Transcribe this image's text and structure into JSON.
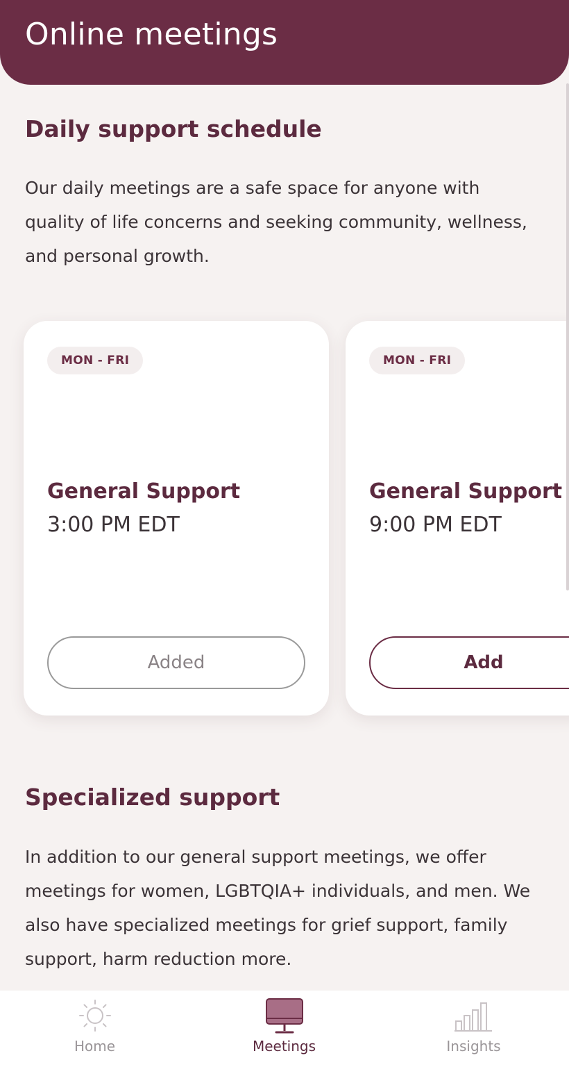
{
  "header": {
    "title": "Online meetings"
  },
  "daily": {
    "title": "Daily support schedule",
    "body": "Our daily meetings are a safe space for anyone with quality of life concerns and seeking community, wellness, and personal growth."
  },
  "cards": [
    {
      "badge": "MON - FRI",
      "title": "General Support",
      "time": "3:00 PM EDT",
      "button": "Added"
    },
    {
      "badge": "MON - FRI",
      "title": "General Support",
      "time": "9:00 PM EDT",
      "button": "Add"
    }
  ],
  "specialized": {
    "title": "Specialized support",
    "body": "In addition to our general support meetings, we offer meetings for women, LGBTQIA+ individuals, and men. We also have specialized meetings for grief support, family support, harm reduction more."
  },
  "tabs": [
    {
      "label": "Home",
      "icon": "sun-icon"
    },
    {
      "label": "Meetings",
      "icon": "monitor-icon"
    },
    {
      "label": "Insights",
      "icon": "bar-chart-icon"
    }
  ],
  "active_tab": "Meetings",
  "colors": {
    "brand": "#6b2d45",
    "background": "#f6f2f1",
    "card": "#ffffff",
    "badge": "#f3eeee"
  }
}
